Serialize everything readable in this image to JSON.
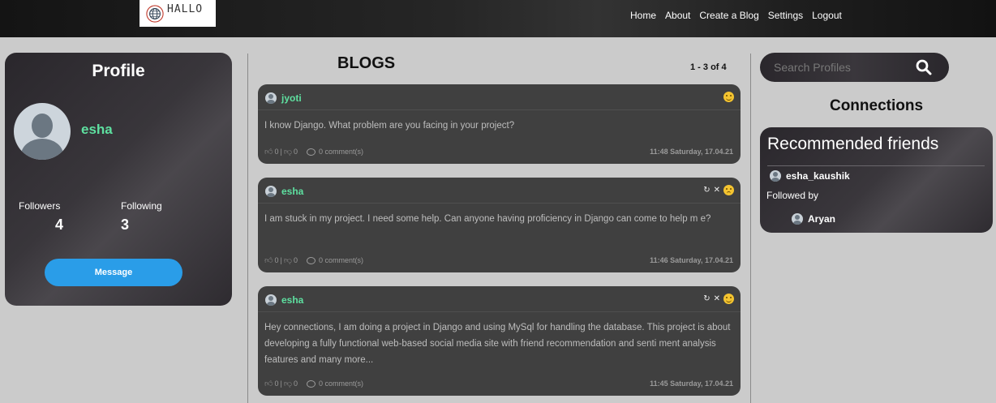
{
  "nav": {
    "logo_text": "HALLO",
    "links": [
      "Home",
      "About",
      "Create a Blog",
      "Settings",
      "Logout"
    ]
  },
  "profile": {
    "title": "Profile",
    "username": "esha",
    "followers_label": "Followers",
    "followers_count": "4",
    "following_label": "Following",
    "following_count": "3",
    "message_button": "Message"
  },
  "blogs": {
    "title": "BLOGS",
    "pagination": "1 - 3 of 4",
    "posts": [
      {
        "author": "jyoti",
        "text": "I know Django. What problem are you facing in your project?",
        "likes": "0",
        "dislikes": "0",
        "comments": "0 comment(s)",
        "timestamp": "11:48 Saturday, 17.04.21",
        "mood": "happy",
        "editable": false
      },
      {
        "author": "esha",
        "text": "I am stuck in my project. I need some help. Can anyone having proficiency in Django can come to help m e?",
        "likes": "0",
        "dislikes": "0",
        "comments": "0 comment(s)",
        "timestamp": "11:46 Saturday, 17.04.21",
        "mood": "sad",
        "editable": true
      },
      {
        "author": "esha",
        "text": "Hey connections, I am doing a project in Django and using MySql for handling the database. This project is about developing a fully functional web-based social media site with friend recommendation and senti ment analysis features and many more...",
        "likes": "0",
        "dislikes": "0",
        "comments": "0 comment(s)",
        "timestamp": "11:45 Saturday, 17.04.21",
        "mood": "happy",
        "editable": true
      }
    ]
  },
  "search": {
    "placeholder": "Search Profiles"
  },
  "connections": {
    "title": "Connections",
    "recommended_title": "Recommended friends",
    "friend_name": "esha_kaushik",
    "followed_by_label": "Followed by",
    "followed_by_name": "Aryan"
  },
  "colors": {
    "accent_green": "#5ee0a0",
    "button_blue": "#2a9de8",
    "card_dark": "#404040"
  }
}
